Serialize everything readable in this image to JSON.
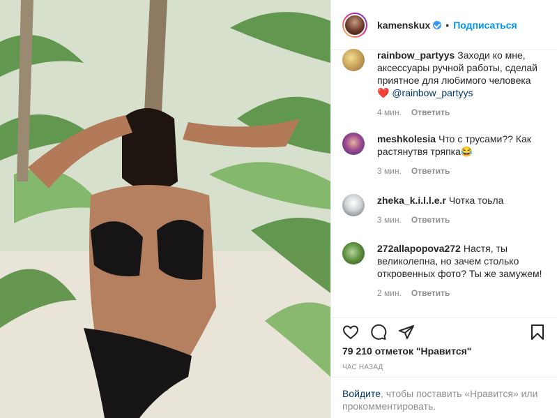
{
  "post": {
    "username": "kamenskux",
    "separator": "•",
    "follow_label": "Подписаться"
  },
  "comments": [
    {
      "username": "rainbow_partyys",
      "text": "Заходи ко мне, аксессуары ручной работы,  сделай приятное для любимого человека",
      "emoji": "❤️",
      "mention": "@rainbow_partyys",
      "time": "4 мин.",
      "reply": "Ответить"
    },
    {
      "username": "meshkolesia",
      "text": "Что с трусами?? Как растянутвя тряпка😂",
      "time": "3 мин.",
      "reply": "Ответить"
    },
    {
      "username": "zheka_k.i.l.l.e.r",
      "text": "Чотка тоьла",
      "time": "3 мин.",
      "reply": "Ответить"
    },
    {
      "username": "272allapopova272",
      "text": "Настя, ты великолепна, но зачем столько откровенных фото? Ты же замужем!",
      "time": "2 мин.",
      "reply": "Ответить"
    }
  ],
  "stats": {
    "likes": "79 210 отметок \"Нравится\"",
    "posted": "ЧАС НАЗАД"
  },
  "login": {
    "link": "Войдите",
    "rest": ", чтобы поставить «Нравится» или прокомментировать."
  },
  "icons": {
    "like": "heart-icon",
    "comment": "comment-icon",
    "share": "share-icon",
    "save": "bookmark-icon"
  },
  "colors": {
    "accent": "#0095f6",
    "verified": "#3897f0",
    "muted": "#8e8e8e",
    "text": "#262626"
  }
}
